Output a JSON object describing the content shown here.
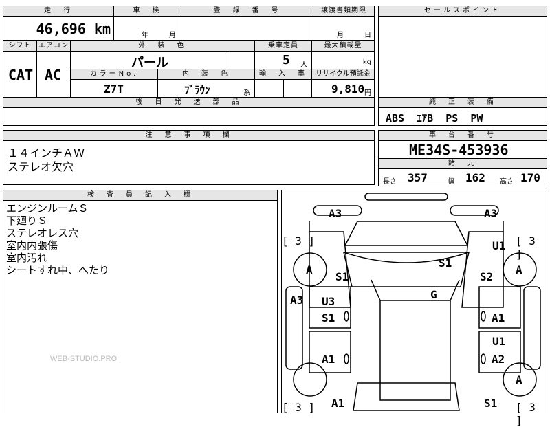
{
  "header": {
    "mileage_label": "走　行",
    "mileage": "46,696 km",
    "inspection_label": "車　検",
    "inspection_year": "年",
    "inspection_month": "月",
    "registration_label": "登　録　番　号",
    "transfer_label": "譲渡書類期限",
    "transfer_month": "月",
    "transfer_day": "日",
    "sales_label": "セールスポイント"
  },
  "specs": {
    "shift_label": "シフト",
    "shift": "CAT",
    "ac_label": "エアコン",
    "ac": "AC",
    "exterior_label": "外　装　色",
    "exterior": "パール",
    "capacity_label": "乗車定員",
    "capacity": "5",
    "capacity_unit": "人",
    "maxload_label": "最大積載量",
    "maxload_unit": "kg",
    "color_no_label": "カラーNo.",
    "color_no": "Z7T",
    "interior_label": "内　装　色",
    "interior": "ﾌﾞﾗｳﾝ",
    "interior_suffix": "系",
    "import_label": "輸　入　車",
    "recycle_label": "リサイクル預託金",
    "recycle": "9,810",
    "recycle_unit": "円"
  },
  "equipment": {
    "delivery_label": "後　日　発　送　部　品",
    "genuine_label": "純　正　装　備",
    "genuine": "ABS  ｴｱB  PS  PW"
  },
  "notes": {
    "label": "注　意　事　項　欄",
    "line1": "１４インチＡＷ",
    "line2": "ステレオ欠穴"
  },
  "chassis": {
    "label": "車　台　番　号",
    "number": "ME34S-453936"
  },
  "dimensions": {
    "label": "諸　元",
    "length_label": "長さ",
    "length": "357",
    "width_label": "幅",
    "width": "162",
    "height_label": "高さ",
    "height": "170"
  },
  "inspector": {
    "label": "検　査　員　記　入　欄",
    "lines": [
      "エンジンルームＳ",
      "下廻りＳ",
      "ステレオレス穴",
      "室内内張傷",
      "室内汚れ",
      "シートすれ中、へたり"
    ]
  },
  "watermark": "WEB-STUDIO.PRO",
  "diagram": {
    "marks": {
      "a3_fl": "A3",
      "a3_fr": "A3",
      "bracket_l": "[ 3 ]",
      "bracket_r": "[ 3 ]",
      "tire_fl": "A",
      "tire_fr": "A",
      "tire_rr": "A",
      "u1_fr": "U1",
      "s1_roof": "S1",
      "s1_fl": "S1",
      "s2_fr": "S2",
      "a3_l": "A3",
      "u3_l": "U3",
      "s1_ld": "S1",
      "g_roof": "G",
      "a1_rd": "A1",
      "u1_rr": "U1",
      "a1_lr": "A1",
      "a2_rr": "A2",
      "a1_bl": "A1",
      "s1_br": "S1",
      "bracket_bl": "[ 3 ]",
      "bracket_br": "[ 3 ]"
    }
  }
}
